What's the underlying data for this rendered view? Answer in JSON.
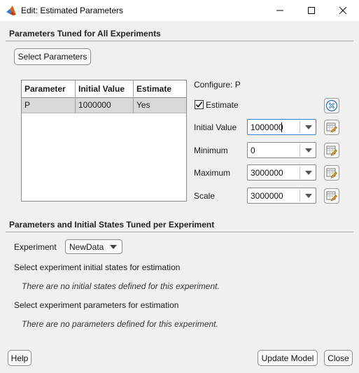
{
  "window": {
    "title": "Edit: Estimated Parameters",
    "app_icon": "matlab-logo-icon"
  },
  "section_all": {
    "title": "Parameters Tuned for All Experiments",
    "select_button": "Select Parameters",
    "table": {
      "headers": [
        "Parameter",
        "Initial Value",
        "Estimate"
      ],
      "rows": [
        {
          "parameter": "P",
          "initial_value": "1000000",
          "estimate": "Yes"
        }
      ],
      "selected_row_color": "#d9d9d9"
    },
    "configure": {
      "title": "Configure: P",
      "estimate_label": "Estimate",
      "estimate_checked": true,
      "fields": [
        {
          "label": "Initial Value",
          "value": "1000000"
        },
        {
          "label": "Minimum",
          "value": "0"
        },
        {
          "label": "Maximum",
          "value": "3000000"
        },
        {
          "label": "Scale",
          "value": "3000000"
        }
      ]
    }
  },
  "section_per": {
    "title": "Parameters and Initial States Tuned per Experiment",
    "experiment_label": "Experiment",
    "experiment_value": "NewData",
    "states_heading": "Select experiment initial states for estimation",
    "states_empty": "There are no initial states defined for this experiment.",
    "params_heading": "Select experiment parameters for estimation",
    "params_empty": "There are no parameters defined for this experiment."
  },
  "footer": {
    "help": "Help",
    "update_model": "Update Model",
    "close": "Close"
  },
  "colors": {
    "background": "#f0f0f0",
    "focus_border": "#3b7fd4",
    "close_icon_blue": "#2f6fc0"
  }
}
